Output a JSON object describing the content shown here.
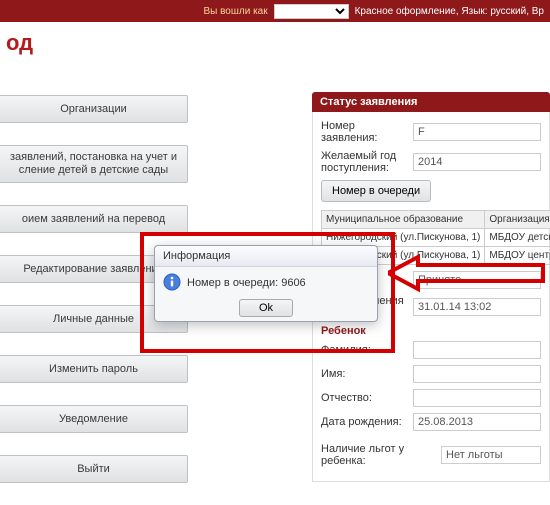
{
  "topbar": {
    "login_prefix": "Вы вошли как",
    "login_select_value": "",
    "theme_note": "Красное оформление, Язык: русский, Вр"
  },
  "title": "од",
  "sidebar": {
    "items": [
      "Организации",
      "заявлений, постановка на учет и сление детей в детские сады ",
      "оием заявлений на перевод",
      "Редактирование заявления",
      "Личные данные",
      "Изменить пароль",
      "Уведомление",
      "Выйти"
    ]
  },
  "panel": {
    "title": "Статус заявления",
    "app_no_label": "Номер заявления:",
    "app_no_value": "                   F",
    "year_label": "Желаемый год поступления:",
    "year_value": "2014",
    "queue_btn": "Номер в очереди",
    "table": {
      "headers": [
        "Муниципальное образование",
        "Организация"
      ],
      "rows": [
        [
          "Нижегородский (ул.Пискунова, 1)",
          "МБДОУ детский сад комбинированного N"
        ],
        [
          "Нижегородский (ул.Пискунова, 1)",
          "МБДОУ центр развития ребенка-детски N"
        ]
      ]
    },
    "status_value": "Принято",
    "status_date_label": "Дата изменения статуса:",
    "status_date_value": "31.01.14 13:02",
    "child_group": "Ребенок",
    "lastname_label": "Фамилия:",
    "lastname_value": "",
    "firstname_label": "Имя:",
    "firstname_value": "",
    "patronymic_label": "Отчество:",
    "patronymic_value": "",
    "birth_label": "Дата рождения:",
    "birth_value": "25.08.2013",
    "benefits_label": "Наличие льгот у ребенка:",
    "benefits_value": "Нет льготы"
  },
  "dialog": {
    "title": "Информация",
    "message": "Номер в очереди: 9606",
    "ok": "Ok"
  }
}
